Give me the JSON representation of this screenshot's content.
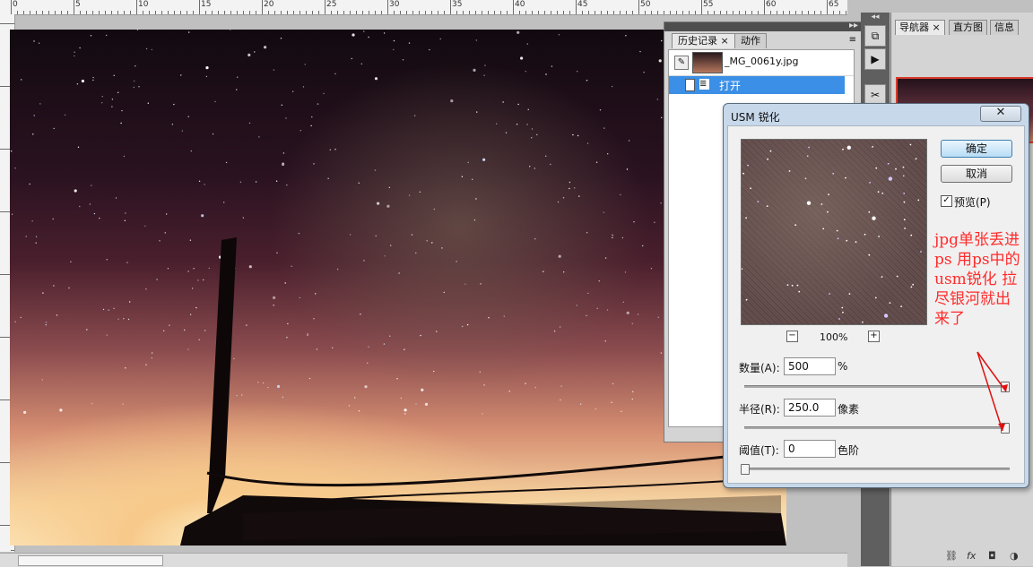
{
  "ruler": {
    "labels": [
      "0",
      "5",
      "10",
      "15",
      "20",
      "25",
      "30",
      "35",
      "40",
      "45",
      "50",
      "55",
      "60",
      "65"
    ]
  },
  "history_panel": {
    "tabs": [
      {
        "label": "历史记录",
        "active": true
      },
      {
        "label": "动作",
        "active": false
      }
    ],
    "snapshot_name": "_MG_0061y.jpg",
    "entries": [
      {
        "label": "打开"
      }
    ]
  },
  "navigator_panel": {
    "tabs": [
      {
        "label": "导航器",
        "active": true
      },
      {
        "label": "直方图",
        "active": false
      },
      {
        "label": "信息",
        "active": false
      }
    ]
  },
  "dialog": {
    "title": "USM 锐化",
    "ok_label": "确定",
    "cancel_label": "取消",
    "preview_label": "预览(P)",
    "preview_checked": true,
    "zoom": "100%",
    "amount": {
      "label": "数量(A):",
      "value": "500",
      "unit": "%",
      "level": 1.0
    },
    "radius": {
      "label": "半径(R):",
      "value": "250.0",
      "unit": "像素",
      "level": 1.0
    },
    "threshold": {
      "label": "阈值(T):",
      "value": "0",
      "unit": "色阶",
      "level": 0.0
    }
  },
  "annotation": {
    "text": "jpg单张丢进\nps 用ps中的\nusm锐化 拉\n尽银河就出\n来了",
    "color": "#ff2b2b"
  },
  "colors": {
    "accent": "#3b8fe6",
    "dialog_frame": "#c7d8ea"
  }
}
